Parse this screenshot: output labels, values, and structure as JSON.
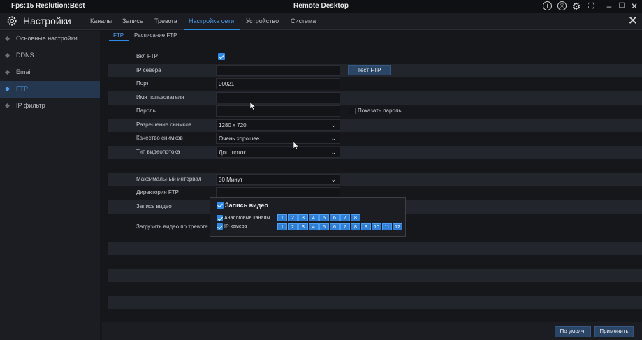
{
  "titlebar": {
    "fps_text": "Fps:15 Reslution:Best",
    "window_title": "Remote Desktop",
    "controls": [
      "info-icon",
      "record-icon",
      "settings-gear-icon",
      "fullscreen-icon",
      "minimize-icon",
      "maximize-icon",
      "close-icon"
    ]
  },
  "menubar": {
    "app_title": "Настройки",
    "tabs": [
      "Каналы",
      "Запись",
      "Тревога",
      "Настройка сети",
      "Устройство",
      "Система"
    ],
    "active_tab": "Настройка сети"
  },
  "sidebar": {
    "items": [
      "Основные настройки",
      "DDNS",
      "Email",
      "FTP",
      "IP фильтр"
    ],
    "active": "FTP"
  },
  "subtabs": {
    "items": [
      "FTP",
      "Расписание FTP"
    ],
    "active": "FTP"
  },
  "form": {
    "enable_ftp_label": "Вкл FTP",
    "enable_ftp_checked": true,
    "ip_server_label": "IP севера",
    "ip_server_value": "",
    "test_ftp_button": "Тест FTP",
    "port_label": "Порт",
    "port_value": "00021",
    "username_label": "Имя пользователя",
    "username_value": "",
    "password_label": "Пароль",
    "password_value": "",
    "show_password_label": "Показать пароль",
    "show_password_checked": false,
    "resolution_label": "Разрешение снимков",
    "resolution_value": "1280 x 720",
    "quality_label": "Качество снимков",
    "quality_value": "Очень хорошее",
    "stream_label": "Тип видеопотока",
    "stream_value": "Доп. поток",
    "max_interval_label": "Максимальный интервал",
    "max_interval_value": "30 Минут",
    "ftp_dir_label": "Директория FTP",
    "ftp_dir_value": "",
    "record_video_label": "Запись видео",
    "upload_alarm_label": "Загрузить видео по тревоге"
  },
  "popup": {
    "title": "Запись видео",
    "title_checked": true,
    "analog_label": "Аналоговые каналы",
    "analog_checked": true,
    "analog_channels": [
      "1",
      "2",
      "3",
      "4",
      "5",
      "6",
      "7",
      "8"
    ],
    "ip_label": "IP-камера",
    "ip_checked": true,
    "ip_channels": [
      "1",
      "2",
      "3",
      "4",
      "5",
      "6",
      "7",
      "8",
      "9",
      "10",
      "11",
      "12"
    ]
  },
  "footer": {
    "default_button": "По умолч.",
    "apply_button": "Применить"
  },
  "colors": {
    "accent": "#2f8ae6",
    "background": "#15171b",
    "panel": "#1b1d22",
    "row_shade": "#22252b"
  }
}
